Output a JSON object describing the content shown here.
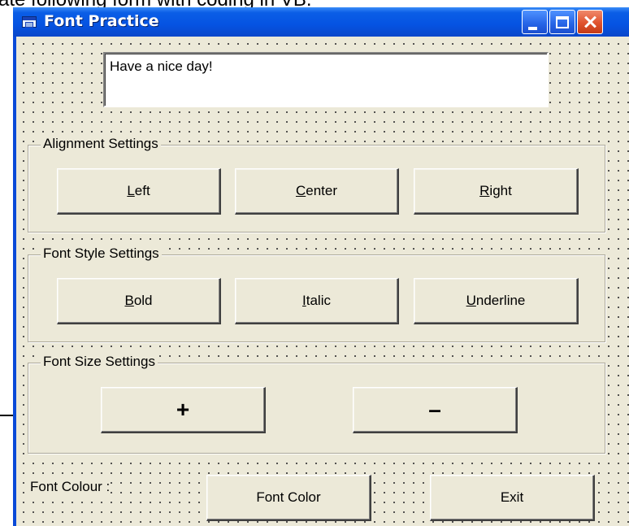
{
  "caption": "ate following form with coding in VB.",
  "window": {
    "title": "Font Practice"
  },
  "textbox": {
    "value": "Have a nice day!"
  },
  "alignment": {
    "label": "Alignment Settings",
    "left": {
      "prefix": "",
      "accel": "L",
      "rest": "eft"
    },
    "center": {
      "prefix": "",
      "accel": "C",
      "rest": "enter"
    },
    "right": {
      "prefix": "",
      "accel": "R",
      "rest": "ight"
    }
  },
  "style": {
    "label": "Font Style Settings",
    "bold": {
      "prefix": "",
      "accel": "B",
      "rest": "old"
    },
    "italic": {
      "prefix": "",
      "accel": "I",
      "rest": "talic"
    },
    "underline": {
      "prefix": "",
      "accel": "U",
      "rest": "nderline"
    }
  },
  "size": {
    "label": "Font Size Settings",
    "increase": "+",
    "decrease": "–"
  },
  "bottom": {
    "colour_label": "Font Colour :",
    "font_color_button": "Font Color",
    "exit_button": "Exit"
  }
}
